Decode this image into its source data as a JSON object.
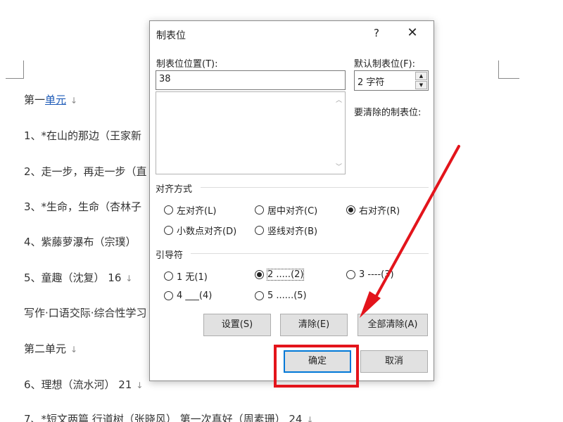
{
  "document": {
    "lines": [
      {
        "prefix": "第一",
        "link": "单元",
        "suffix": ""
      },
      {
        "prefix": "1、*在山的那边（王家新",
        "link": "",
        "suffix": ""
      },
      {
        "prefix": "2、走一步，再走一步（直",
        "link": "",
        "suffix": ""
      },
      {
        "prefix": "3、*生命，生命（杏林子",
        "link": "",
        "suffix": ""
      },
      {
        "prefix": "4、紫藤萝瀑布（宗璞）",
        "link": "",
        "suffix": ""
      },
      {
        "prefix": "5、童趣（沈复）   16",
        "link": "",
        "suffix": ""
      },
      {
        "prefix": "写作·口语交际·综合性学习",
        "link": "",
        "suffix": ""
      },
      {
        "prefix": "第二单元",
        "link": "",
        "suffix": ""
      },
      {
        "prefix": "6、理想（流水河）         21",
        "link": "",
        "suffix": ""
      },
      {
        "prefix": "7、*短文两篇  行道树（张晓风）  第一次真好（周素珊）         24",
        "link": "",
        "suffix": ""
      }
    ],
    "para_mark": "↓"
  },
  "dialog": {
    "title": "制表位",
    "help_label": "?",
    "close_label": "✕",
    "tab_position_label": "制表位位置(T):",
    "tab_position_value": "38",
    "default_tab_label": "默认制表位(F):",
    "default_tab_value": "2 字符",
    "clear_tabs_label": "要清除的制表位:",
    "alignment": {
      "title": "对齐方式",
      "options": [
        {
          "label": "左对齐(L)",
          "selected": false
        },
        {
          "label": "居中对齐(C)",
          "selected": false
        },
        {
          "label": "右对齐(R)",
          "selected": true
        },
        {
          "label": "小数点对齐(D)",
          "selected": false
        },
        {
          "label": "竖线对齐(B)",
          "selected": false
        }
      ]
    },
    "leader": {
      "title": "引导符",
      "options": [
        {
          "label": "1 无(1)",
          "selected": false
        },
        {
          "label": "2 .....(2)",
          "selected": true
        },
        {
          "label": "3 ----(3)",
          "selected": false
        },
        {
          "label": "4 ___(4)",
          "selected": false
        },
        {
          "label": "5 ......(5)",
          "selected": false
        }
      ]
    },
    "buttons": {
      "set": "设置(S)",
      "clear": "清除(E)",
      "clear_all": "全部清除(A)",
      "ok": "确定",
      "cancel": "取消"
    }
  },
  "colors": {
    "annotation_red": "#e3141b",
    "link_blue": "#1e5bb8",
    "focus_blue": "#0078d7"
  }
}
